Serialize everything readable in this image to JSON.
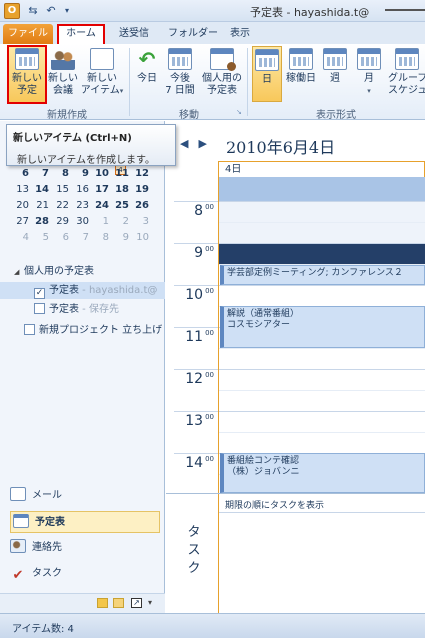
{
  "window": {
    "title": "予定表 - hayashida.t@"
  },
  "tabs": [
    "ファイル",
    "ホーム",
    "送受信",
    "フォルダー",
    "表示"
  ],
  "ribbon": {
    "new_group": {
      "label": "新規作成",
      "buttons": [
        {
          "label1": "新しい",
          "label2": "予定"
        },
        {
          "label1": "新しい",
          "label2": "会議"
        },
        {
          "label1": "新しい",
          "label2": "アイテム"
        }
      ]
    },
    "move_group": {
      "label": "移動",
      "buttons": [
        {
          "label1": "今日",
          "label2": ""
        },
        {
          "label1": "今後",
          "label2": "7 日間"
        },
        {
          "label1": "個人用の",
          "label2": "予定表"
        }
      ]
    },
    "view_group": {
      "label": "表示形式",
      "buttons": [
        {
          "label1": "日",
          "label2": ""
        },
        {
          "label1": "稼働日",
          "label2": ""
        },
        {
          "label1": "週",
          "label2": ""
        },
        {
          "label1": "月",
          "label2": ""
        },
        {
          "label1": "グループ",
          "label2": "スケジュー"
        }
      ]
    }
  },
  "tooltip": {
    "title": "新しいアイテム (Ctrl+N)",
    "description": "新しいアイテムを作成します。"
  },
  "mini_calendar": {
    "rows": [
      [
        {
          "d": "6",
          "s": "bold"
        },
        {
          "d": "7",
          "s": "bold"
        },
        {
          "d": "8",
          "s": "bold"
        },
        {
          "d": "9",
          "s": "bold"
        },
        {
          "d": "10",
          "s": "bold"
        },
        {
          "d": "11",
          "s": "bold"
        },
        {
          "d": "12",
          "s": "bold"
        }
      ],
      [
        {
          "d": "13",
          "s": ""
        },
        {
          "d": "14",
          "s": "bold"
        },
        {
          "d": "15",
          "s": ""
        },
        {
          "d": "16",
          "s": ""
        },
        {
          "d": "17",
          "s": "bold"
        },
        {
          "d": "18",
          "s": "bold"
        },
        {
          "d": "19",
          "s": "bold"
        }
      ],
      [
        {
          "d": "20",
          "s": ""
        },
        {
          "d": "21",
          "s": ""
        },
        {
          "d": "22",
          "s": ""
        },
        {
          "d": "23",
          "s": ""
        },
        {
          "d": "24",
          "s": "bold"
        },
        {
          "d": "25",
          "s": "bold"
        },
        {
          "d": "26",
          "s": "bold"
        }
      ],
      [
        {
          "d": "27",
          "s": ""
        },
        {
          "d": "28",
          "s": "bold"
        },
        {
          "d": "29",
          "s": ""
        },
        {
          "d": "30",
          "s": ""
        },
        {
          "d": "1",
          "s": "grey"
        },
        {
          "d": "2",
          "s": "grey"
        },
        {
          "d": "3",
          "s": "grey"
        }
      ],
      [
        {
          "d": "4",
          "s": "grey"
        },
        {
          "d": "5",
          "s": "grey"
        },
        {
          "d": "6",
          "s": "grey"
        },
        {
          "d": "7",
          "s": "grey"
        },
        {
          "d": "8",
          "s": "grey"
        },
        {
          "d": "9",
          "s": "grey"
        },
        {
          "d": "10",
          "s": "grey"
        }
      ]
    ]
  },
  "folders": {
    "group_label": "個人用の予定表",
    "items": [
      {
        "label": "予定表",
        "sub": " - hayashida.t@",
        "checked": "✓"
      },
      {
        "label": "予定表",
        "sub": " - 保存先",
        "checked": ""
      }
    ],
    "other": {
      "label": "新規プロジェクト 立ち上げ",
      "checked": ""
    }
  },
  "nav_buttons": [
    "メール",
    "予定表",
    "連絡先",
    "タスク"
  ],
  "calendar": {
    "date_title": "2010年6月4日",
    "day_header": "4日",
    "hours": [
      "8",
      "9",
      "10",
      "11",
      "12",
      "13",
      "14"
    ],
    "minute_suffix": "00",
    "appointments": [
      {
        "line1": "学芸部定例ミーティング; カンファレンス２",
        "line2": ""
      },
      {
        "line1": "解説（通常番組）",
        "line2": "コスモシアター"
      },
      {
        "line1": "番組絵コンテ確認",
        "line2": "（株）ジョバンニ"
      }
    ],
    "tasks_label": "タスク",
    "tasks_text": "期限の順にタスクを表示"
  },
  "status": {
    "item_count": "アイテム数: 4"
  },
  "colors": {
    "accent_orange": "#e7a12c",
    "highlight_red": "#e30000",
    "appointment_blue": "#cfe0f5",
    "now_bar": "#243f68"
  }
}
